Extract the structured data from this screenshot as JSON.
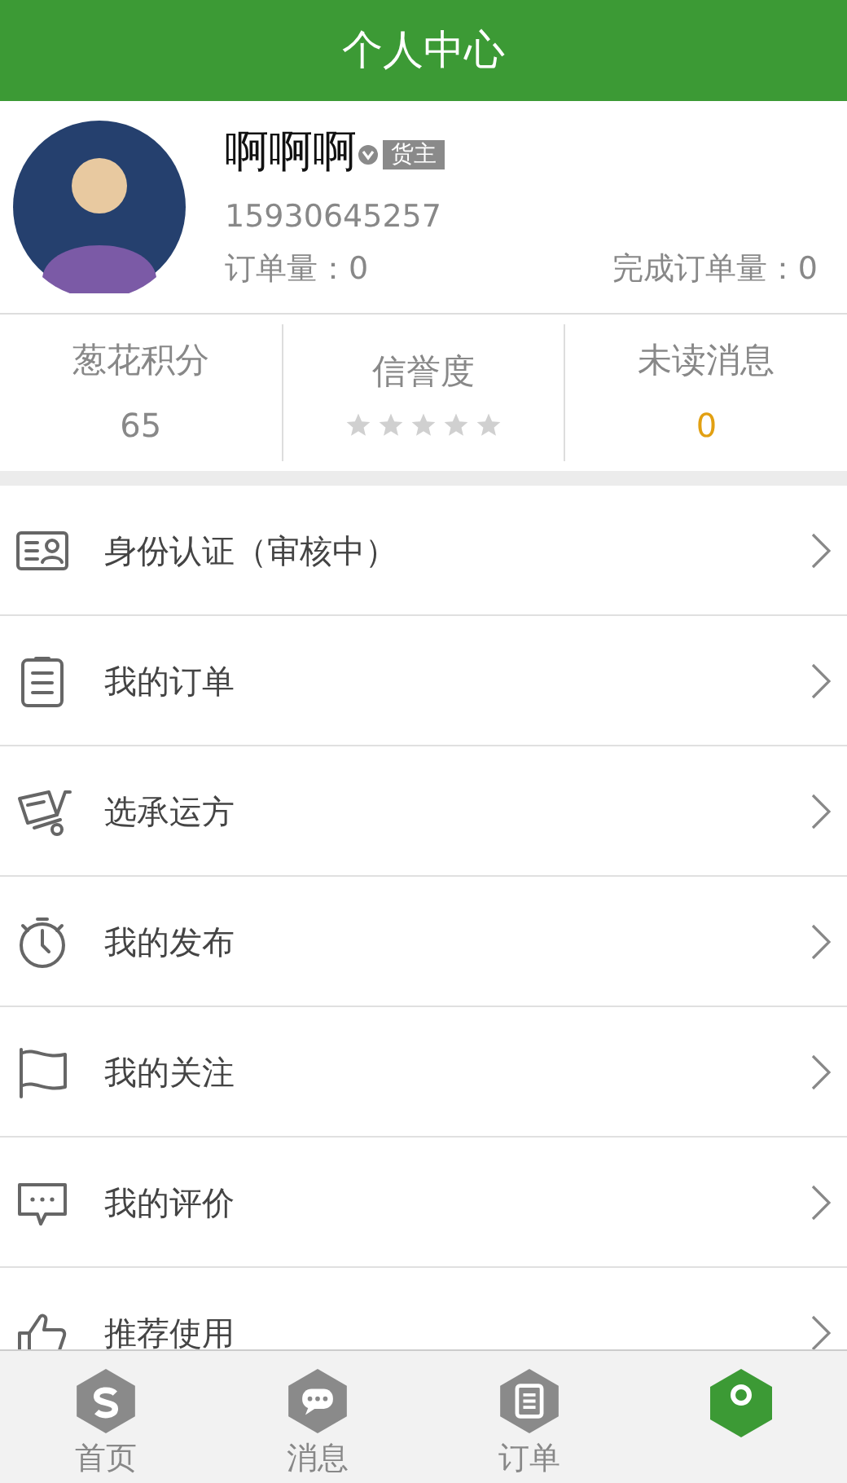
{
  "header": {
    "title": "个人中心"
  },
  "profile": {
    "name": "啊啊啊",
    "verified": true,
    "role_badge": "货主",
    "phone": "15930645257",
    "order_count": "订单量：0",
    "completed_count": "完成订单量：0"
  },
  "stats": [
    {
      "kind": "value",
      "label": "葱花积分",
      "value": "65"
    },
    {
      "kind": "stars",
      "label": "信誉度",
      "stars": 0
    },
    {
      "kind": "highlight",
      "label": "未读消息",
      "value": "0"
    }
  ],
  "menu": [
    {
      "label": "身份认证（审核中）"
    },
    {
      "label": "我的订单"
    },
    {
      "label": "选承运方"
    },
    {
      "label": "我的发布"
    },
    {
      "label": "我的关注"
    },
    {
      "label": "我的评价"
    },
    {
      "label": "推荐使用"
    }
  ],
  "tabs": [
    {
      "label": "首页",
      "selected": false
    },
    {
      "label": "消息",
      "selected": false
    },
    {
      "label": "订单",
      "selected": false
    },
    {
      "selected": true
    }
  ]
}
